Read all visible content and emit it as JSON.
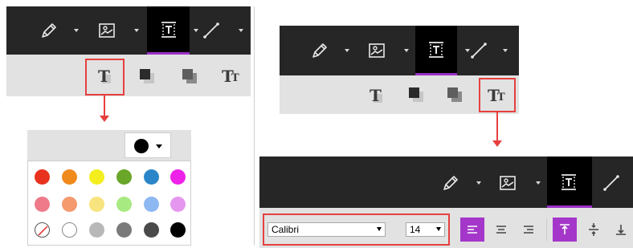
{
  "colors": {
    "dark_toolbar": "#262626",
    "light_toolbar": "#e2e2e2",
    "accent_purple": "#a437c9",
    "highlight_red": "#e5403f",
    "selected_color": "#000000"
  },
  "toolbar_tools": [
    {
      "name": "pen-icon",
      "has_dropdown": true
    },
    {
      "name": "image-icon",
      "has_dropdown": true
    },
    {
      "name": "text-box-icon",
      "has_dropdown": true,
      "active": true
    },
    {
      "name": "line-icon",
      "has_dropdown": true
    }
  ],
  "text_style_tools": [
    {
      "name": "text-color-icon",
      "glyph": "T"
    },
    {
      "name": "fill-color-icon"
    },
    {
      "name": "border-color-icon"
    },
    {
      "name": "font-settings-icon",
      "glyph": "T",
      "sub_glyph": "T"
    }
  ],
  "palette": {
    "rows": [
      [
        "#e8321d",
        "#f18a1c",
        "#f4ee1e",
        "#6aa628",
        "#2a86c9",
        "#ee21e8"
      ],
      [
        "#ee7a8a",
        "#f49a6e",
        "#f8e47e",
        "#a8ea82",
        "#8eb8f2",
        "#e597ef"
      ],
      [
        "none",
        "#ffffff",
        "#b8b8b8",
        "#7a7a7a",
        "#4a4a4a",
        "#000000"
      ]
    ]
  },
  "font_panel": {
    "font_family": "Calibri",
    "font_size": "14"
  },
  "alignment": {
    "horizontal": [
      "left",
      "center",
      "right"
    ],
    "horizontal_active": "left",
    "vertical": [
      "top",
      "middle",
      "bottom"
    ],
    "vertical_active": "top"
  }
}
